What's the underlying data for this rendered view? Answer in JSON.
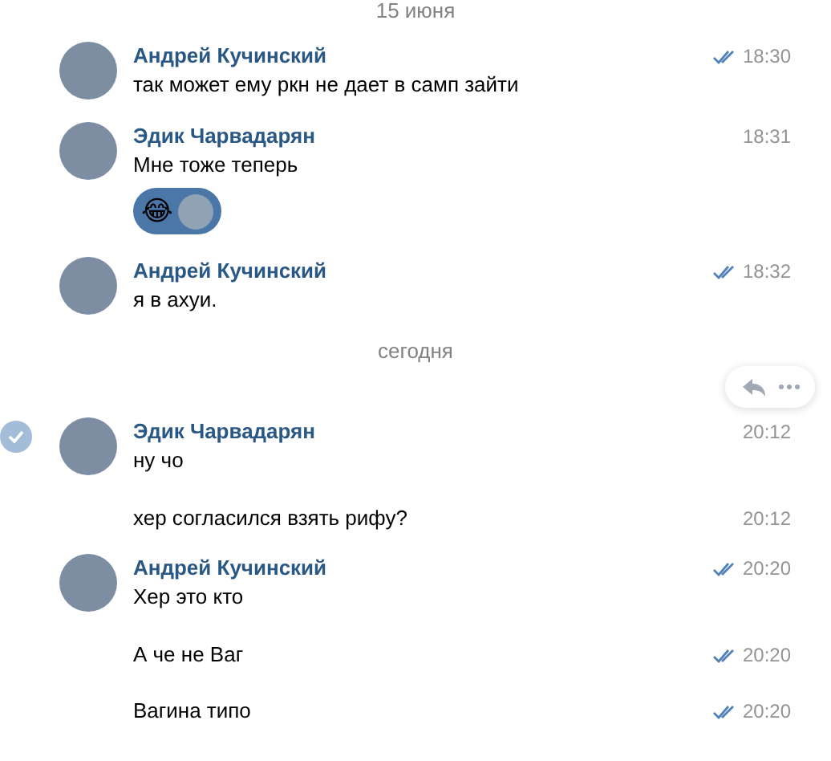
{
  "items": [
    {
      "kind": "date",
      "text": "15 июня"
    },
    {
      "kind": "message",
      "author": "Андрей Кучинский",
      "text": "так может ему ркн не дает в самп зайти",
      "time": "18:30",
      "read_ticks": true,
      "selected": false,
      "hovered": false
    },
    {
      "kind": "message",
      "author": "Эдик Чарвадарян",
      "text": "Мне тоже теперь",
      "time": "18:31",
      "read_ticks": false,
      "selected": false,
      "hovered": false,
      "reaction": {
        "emoji": "😂"
      }
    },
    {
      "kind": "message",
      "author": "Андрей Кучинский",
      "text": "я в ахуи.",
      "time": "18:32",
      "read_ticks": true,
      "selected": false,
      "hovered": false
    },
    {
      "kind": "date",
      "text": "сегодня"
    },
    {
      "kind": "message",
      "author": "Эдик Чарвадарян",
      "text": "ну чо",
      "time": "20:12",
      "read_ticks": false,
      "selected": true,
      "hovered": true
    },
    {
      "kind": "message",
      "text": "хер согласился взять рифу?",
      "time": "20:12",
      "read_ticks": false,
      "selected": false,
      "hovered": false
    },
    {
      "kind": "message",
      "author": "Андрей Кучинский",
      "text": "Хер это кто",
      "time": "20:20",
      "read_ticks": true,
      "selected": false,
      "hovered": false
    },
    {
      "kind": "message",
      "text": "А че не Ваг",
      "time": "20:20",
      "read_ticks": true,
      "selected": false,
      "hovered": false
    },
    {
      "kind": "message",
      "text": "Вагина типо",
      "time": "20:20",
      "read_ticks": true,
      "selected": false,
      "hovered": false
    }
  ]
}
